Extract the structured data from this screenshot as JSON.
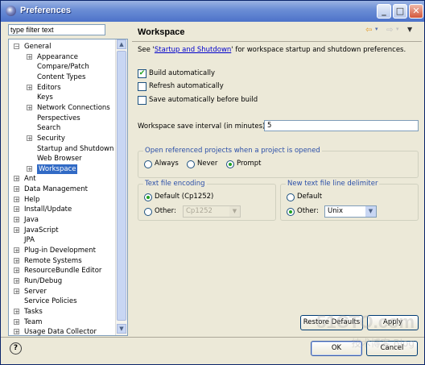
{
  "window": {
    "title": "Preferences"
  },
  "filter": {
    "value": "type filter text"
  },
  "tree": {
    "items": [
      {
        "label": "General",
        "toggle": "−"
      },
      {
        "label": "Appearance",
        "toggle": "+"
      },
      {
        "label": "Compare/Patch",
        "toggle": ""
      },
      {
        "label": "Content Types",
        "toggle": ""
      },
      {
        "label": "Editors",
        "toggle": "+"
      },
      {
        "label": "Keys",
        "toggle": ""
      },
      {
        "label": "Network Connections",
        "toggle": "+"
      },
      {
        "label": "Perspectives",
        "toggle": ""
      },
      {
        "label": "Search",
        "toggle": ""
      },
      {
        "label": "Security",
        "toggle": "+"
      },
      {
        "label": "Startup and Shutdown",
        "toggle": ""
      },
      {
        "label": "Web Browser",
        "toggle": ""
      },
      {
        "label": "Workspace",
        "toggle": "+"
      },
      {
        "label": "Ant",
        "toggle": "+"
      },
      {
        "label": "Data Management",
        "toggle": "+"
      },
      {
        "label": "Help",
        "toggle": "+"
      },
      {
        "label": "Install/Update",
        "toggle": "+"
      },
      {
        "label": "Java",
        "toggle": "+"
      },
      {
        "label": "JavaScript",
        "toggle": "+"
      },
      {
        "label": "JPA",
        "toggle": ""
      },
      {
        "label": "Plug-in Development",
        "toggle": "+"
      },
      {
        "label": "Remote Systems",
        "toggle": "+"
      },
      {
        "label": "ResourceBundle Editor",
        "toggle": "+"
      },
      {
        "label": "Run/Debug",
        "toggle": "+"
      },
      {
        "label": "Server",
        "toggle": "+"
      },
      {
        "label": "Service Policies",
        "toggle": ""
      },
      {
        "label": "Tasks",
        "toggle": "+"
      },
      {
        "label": "Team",
        "toggle": "+"
      },
      {
        "label": "Usage Data Collector",
        "toggle": "+"
      }
    ],
    "selected": "Workspace"
  },
  "page": {
    "title": "Workspace",
    "intro_prefix": "See '",
    "intro_link": "Startup and Shutdown",
    "intro_suffix": "' for workspace startup and shutdown preferences.",
    "build_auto": "Build automatically",
    "refresh_auto": "Refresh automatically",
    "save_before_build": "Save automatically before build",
    "interval_label": "Workspace save interval (in minutes):",
    "interval_value": "5",
    "open_group_title": "Open referenced projects when a project is opened",
    "always": "Always",
    "never": "Never",
    "prompt": "Prompt",
    "encoding_group_title": "Text file encoding",
    "enc_default": "Default (Cp1252)",
    "enc_other": "Other:",
    "enc_other_value": "Cp1252",
    "delim_group_title": "New text file line delimiter",
    "delim_default": "Default",
    "delim_other": "Other:",
    "delim_other_value": "Unix",
    "restore_defaults": "Restore Defaults",
    "apply": "Apply"
  },
  "footer": {
    "ok": "OK",
    "cancel": "Cancel"
  },
  "watermark": {
    "site": "51CTO.com",
    "blog": "技术博客 Blog"
  }
}
